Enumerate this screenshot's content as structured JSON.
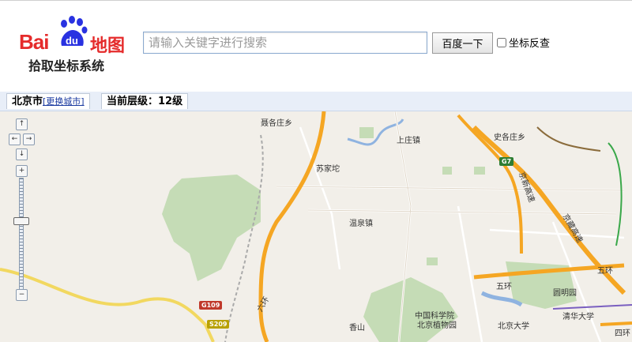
{
  "logo": {
    "brand_text": "Bai",
    "paw_text": "du",
    "map_text": "地图",
    "subtitle": "拾取坐标系统"
  },
  "search": {
    "placeholder": "请输入关键字进行搜索",
    "value": "",
    "button_label": "百度一下"
  },
  "reverse_lookup": {
    "label": "坐标反查",
    "checked": false
  },
  "status": {
    "city": "北京市",
    "change_city": "[更换城市]",
    "zoom_level": "当前层级：12级"
  },
  "map": {
    "places": [
      "聂各庄乡",
      "上庄镇",
      "史各庄乡",
      "苏家坨",
      "温泉镇",
      "中国科学院",
      "北京植物园",
      "香山",
      "北京大学",
      "圆明园",
      "清华大学"
    ],
    "roads": [
      "京新高速",
      "京藏高速",
      "五环",
      "五环",
      "六环",
      "四环"
    ],
    "shields": [
      "G7",
      "G109",
      "S209"
    ]
  },
  "nav": {
    "up": "↑",
    "left": "←",
    "right": "→",
    "down": "↓",
    "zoom_in": "+",
    "zoom_out": "−"
  },
  "colors": {
    "brand_red": "#e52b2b",
    "brand_blue": "#2932e1",
    "highway": "#f5a623",
    "green": "#c5dcb6",
    "water": "#a7c7e6"
  }
}
